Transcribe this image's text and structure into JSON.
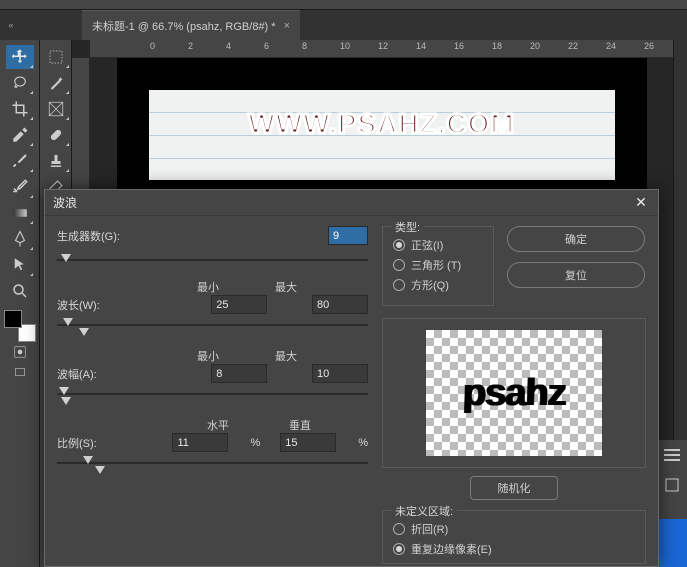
{
  "tab": {
    "title": "未标题-1 @ 66.7% (psahz, RGB/8#) *"
  },
  "ruler": {
    "marks": [
      "0",
      "2",
      "4",
      "6",
      "8",
      "10",
      "12",
      "14",
      "16",
      "18",
      "20",
      "22",
      "24",
      "26"
    ]
  },
  "watermark": "WWW.PSAHZ.COM",
  "dialog": {
    "title": "波浪",
    "generators_label": "生成器数(G):",
    "generators_value": "9",
    "min_label": "最小",
    "max_label": "最大",
    "wavelength_label": "波长(W):",
    "wavelength_min": "25",
    "wavelength_max": "80",
    "amplitude_label": "波幅(A):",
    "amplitude_min": "8",
    "amplitude_max": "10",
    "horiz_label": "水平",
    "vert_label": "垂直",
    "scale_label": "比例(S):",
    "scale_h": "11",
    "scale_v": "15",
    "pct": "%",
    "type": {
      "legend": "类型:",
      "sine": "正弦(I)",
      "triangle": "三角形 (T)",
      "square": "方形(Q)"
    },
    "ok": "确定",
    "reset": "复位",
    "randomize": "随机化",
    "undefined": {
      "legend": "未定义区域:",
      "wrap": "折回(R)",
      "repeat": "重复边缘像素(E)"
    },
    "preview_text": "psahz"
  }
}
